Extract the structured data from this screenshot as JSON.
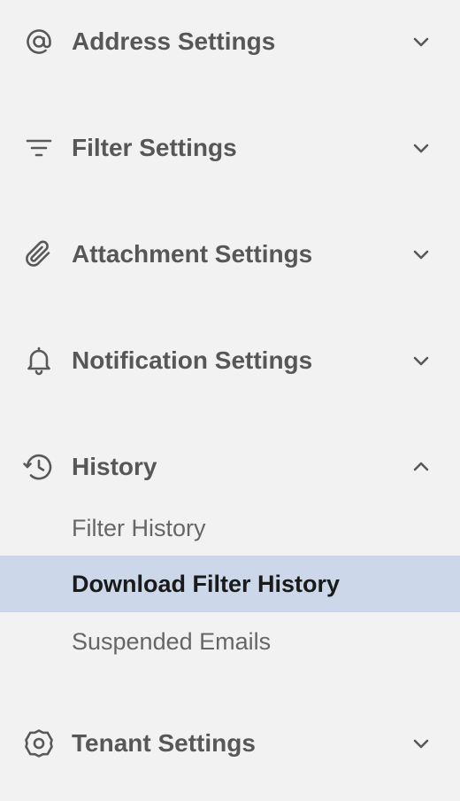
{
  "sections": [
    {
      "label": "Address Settings",
      "icon": "at-sign-icon",
      "expanded": false
    },
    {
      "label": "Filter Settings",
      "icon": "filter-lines-icon",
      "expanded": false
    },
    {
      "label": "Attachment Settings",
      "icon": "paperclip-icon",
      "expanded": false
    },
    {
      "label": "Notification Settings",
      "icon": "bell-icon",
      "expanded": false
    },
    {
      "label": "History",
      "icon": "history-clock-icon",
      "expanded": true
    },
    {
      "label": "Tenant Settings",
      "icon": "gear-icon",
      "expanded": false
    }
  ],
  "history_items": [
    {
      "label": "Filter History",
      "active": false
    },
    {
      "label": "Download Filter History",
      "active": true
    },
    {
      "label": "Suspended Emails",
      "active": false
    }
  ],
  "colors": {
    "background": "#f2f2f2",
    "active_background": "#ccd8ea",
    "text": "#575757",
    "active_text": "#1a1a1a"
  }
}
